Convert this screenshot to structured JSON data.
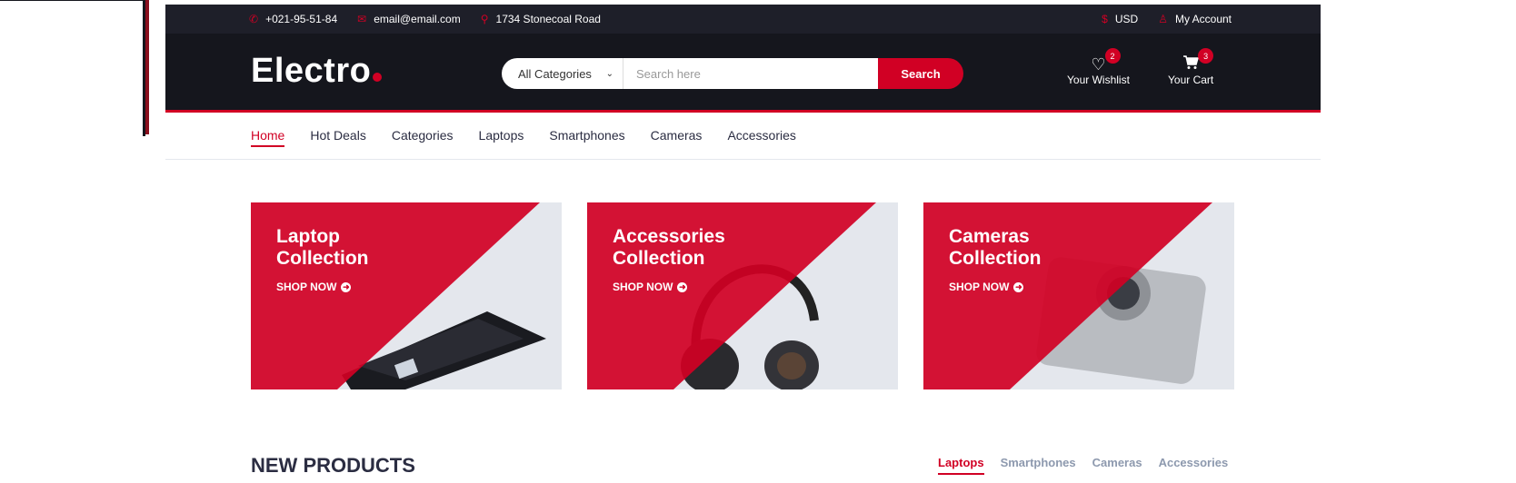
{
  "topbar": {
    "phone": "+021-95-51-84",
    "email": "email@email.com",
    "address": "1734 Stonecoal Road",
    "currency": "USD",
    "account": "My Account",
    "icons": {
      "phone": "phone-icon",
      "email": "envelope-icon",
      "address": "map-marker-icon",
      "currency": "dollar-icon",
      "account": "user-icon"
    }
  },
  "header": {
    "logo": "Electro",
    "category_select": "All Categories",
    "search_placeholder": "Search here",
    "search_button": "Search",
    "wishlist_label": "Your Wishlist",
    "wishlist_count": "2",
    "cart_label": "Your Cart",
    "cart_count": "3"
  },
  "nav": {
    "items": [
      {
        "label": "Home",
        "active": true
      },
      {
        "label": "Hot Deals"
      },
      {
        "label": "Categories"
      },
      {
        "label": "Laptops"
      },
      {
        "label": "Smartphones"
      },
      {
        "label": "Cameras"
      },
      {
        "label": "Accessories"
      }
    ]
  },
  "collections": [
    {
      "title_line1": "Laptop",
      "title_line2": "Collection",
      "cta": "SHOP NOW",
      "image": "laptop"
    },
    {
      "title_line1": "Accessories",
      "title_line2": "Collection",
      "cta": "SHOP NOW",
      "image": "headphones"
    },
    {
      "title_line1": "Cameras",
      "title_line2": "Collection",
      "cta": "SHOP NOW",
      "image": "camera"
    }
  ],
  "new_products": {
    "title": "NEW PRODUCTS",
    "tabs": [
      {
        "label": "Laptops",
        "active": true
      },
      {
        "label": "Smartphones"
      },
      {
        "label": "Cameras"
      },
      {
        "label": "Accessories"
      }
    ]
  },
  "colors": {
    "accent": "#d10024",
    "dark": "#15161d",
    "topbar": "#1e1f29"
  }
}
